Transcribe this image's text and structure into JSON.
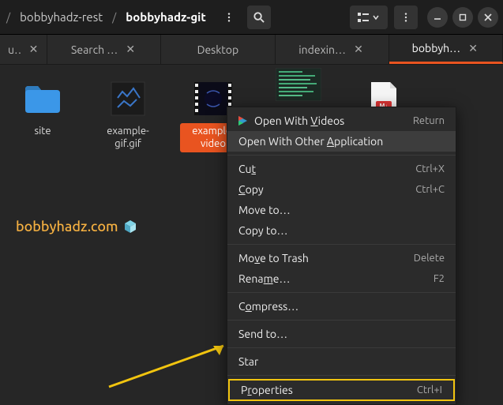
{
  "breadcrumb": {
    "parent": "bobbyhadz-rest",
    "current": "bobbyhadz-git"
  },
  "tabs": [
    {
      "label": "u…"
    },
    {
      "label": "Search …"
    },
    {
      "label": "Desktop"
    },
    {
      "label": "indexin…"
    },
    {
      "label": "bobbyh…"
    }
  ],
  "files": {
    "site": "site",
    "gif": "example-gif.gif",
    "video": "example-video",
    "indexing": "",
    "md": ""
  },
  "watermark": "bobbyhadz.com",
  "menu": {
    "open_videos": {
      "label_pre": "Open With ",
      "label_u": "V",
      "label_post": "ideos",
      "accel": "Return"
    },
    "open_other": {
      "label_pre": "Open With Other ",
      "label_u": "A",
      "label_post": "pplication"
    },
    "cut": {
      "label_pre": "Cu",
      "label_u": "t",
      "label_post": "",
      "accel": "Ctrl+X"
    },
    "copy": {
      "label_pre": "",
      "label_u": "C",
      "label_post": "opy",
      "accel": "Ctrl+C"
    },
    "move_to": {
      "label_pre": "Move to…",
      "label_u": "",
      "label_post": ""
    },
    "copy_to": {
      "label_pre": "Copy to…",
      "label_u": "",
      "label_post": ""
    },
    "trash": {
      "label_pre": "Mo",
      "label_u": "v",
      "label_post": "e to Trash",
      "accel": "Delete"
    },
    "rename": {
      "label_pre": "Rena",
      "label_u": "m",
      "label_post": "e…",
      "accel": "F2"
    },
    "compress": {
      "label_pre": "C",
      "label_u": "o",
      "label_post": "mpress…"
    },
    "send_to": {
      "label_pre": "Send to…",
      "label_u": "",
      "label_post": ""
    },
    "star": {
      "label_pre": "Star",
      "label_u": "",
      "label_post": ""
    },
    "properties": {
      "label_pre": "P",
      "label_u": "r",
      "label_post": "operties",
      "accel": "Ctrl+I"
    }
  }
}
